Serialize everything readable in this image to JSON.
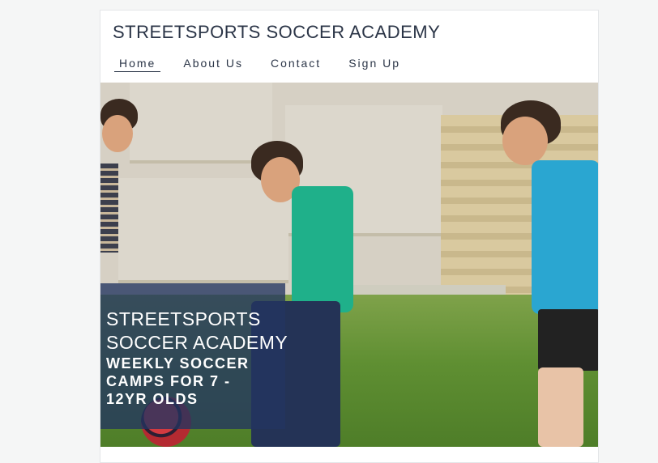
{
  "site": {
    "title": "STREETSPORTS SOCCER ACADEMY"
  },
  "nav": {
    "items": [
      {
        "label": "Home",
        "active": true
      },
      {
        "label": "About Us",
        "active": false
      },
      {
        "label": "Contact",
        "active": false
      },
      {
        "label": "Sign Up",
        "active": false
      }
    ]
  },
  "hero": {
    "heading": "STREETSPORTS SOCCER ACADEMY",
    "subheading": "WEEKLY SOCCER CAMPS FOR 7 - 12YR OLDS",
    "overlay_color": "#223460"
  }
}
